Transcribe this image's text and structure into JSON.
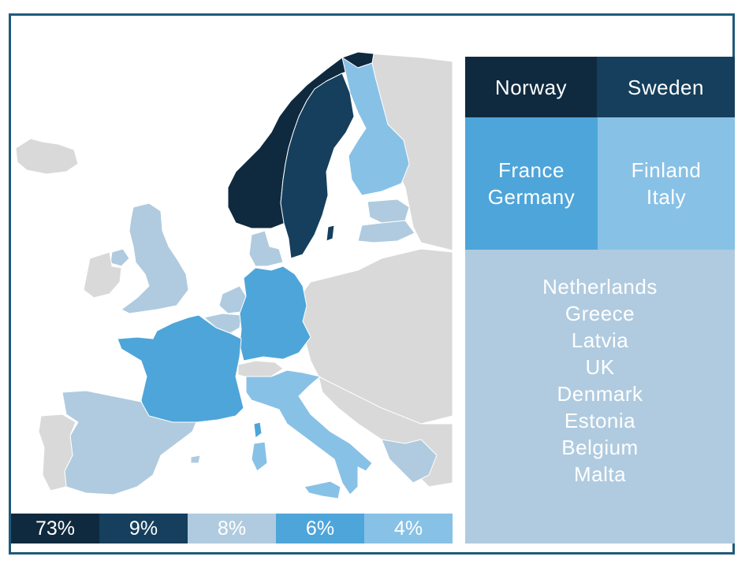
{
  "colors": {
    "frame": "#1f5a7a",
    "other": "#d9d9d9",
    "c73": "#0f2a3f",
    "c9": "#153f5c",
    "c8": "#b0cbdf",
    "c6": "#4ea5d9",
    "c4": "#88c1e6"
  },
  "legend": [
    {
      "label": "73%",
      "value": 73,
      "color": "#0f2a3f"
    },
    {
      "label": "9%",
      "value": 9,
      "color": "#153f5c"
    },
    {
      "label": "8%",
      "value": 8,
      "color": "#b0cbdf"
    },
    {
      "label": "6%",
      "value": 6,
      "color": "#4ea5d9"
    },
    {
      "label": "4%",
      "value": 4,
      "color": "#88c1e6"
    }
  ],
  "groups": [
    {
      "share": "73%",
      "countries": [
        "Norway"
      ]
    },
    {
      "share": "9%",
      "countries": [
        "Sweden"
      ]
    },
    {
      "share": "6%",
      "countries": [
        "France",
        "Germany"
      ]
    },
    {
      "share": "4%",
      "countries": [
        "Finland",
        "Italy"
      ]
    },
    {
      "share": "8%",
      "countries": [
        "Netherlands",
        "Greece",
        "Latvia",
        "UK",
        "Denmark",
        "Estonia",
        "Belgium",
        "Malta"
      ]
    }
  ],
  "treemap": {
    "norway": "Norway",
    "sweden": "Sweden",
    "france_germany": [
      "France",
      "Germany"
    ],
    "finland_italy": [
      "Finland",
      "Italy"
    ],
    "rest": [
      "Netherlands",
      "Greece",
      "Latvia",
      "UK",
      "Denmark",
      "Estonia",
      "Belgium",
      "Malta"
    ]
  },
  "map_regions": [
    {
      "name": "Norway",
      "group": "c73"
    },
    {
      "name": "Sweden",
      "group": "c9"
    },
    {
      "name": "Finland",
      "group": "c4"
    },
    {
      "name": "Estonia",
      "group": "c8"
    },
    {
      "name": "Latvia",
      "group": "c8"
    },
    {
      "name": "Denmark",
      "group": "c8"
    },
    {
      "name": "UK",
      "group": "c8"
    },
    {
      "name": "Ireland",
      "group": "other"
    },
    {
      "name": "Iceland",
      "group": "other"
    },
    {
      "name": "Netherlands",
      "group": "c8"
    },
    {
      "name": "Belgium",
      "group": "c8"
    },
    {
      "name": "Germany",
      "group": "c6"
    },
    {
      "name": "France",
      "group": "c6"
    },
    {
      "name": "Corsica",
      "group": "c6"
    },
    {
      "name": "Spain",
      "group": "c8"
    },
    {
      "name": "Portugal",
      "group": "other"
    },
    {
      "name": "Switzerland",
      "group": "other"
    },
    {
      "name": "Italy",
      "group": "c4"
    },
    {
      "name": "Sardinia",
      "group": "c4"
    },
    {
      "name": "Sicily",
      "group": "c4"
    },
    {
      "name": "Russia",
      "group": "other"
    },
    {
      "name": "Eastern Europe",
      "group": "other"
    },
    {
      "name": "Balkans",
      "group": "other"
    },
    {
      "name": "Greece",
      "group": "c8"
    }
  ]
}
